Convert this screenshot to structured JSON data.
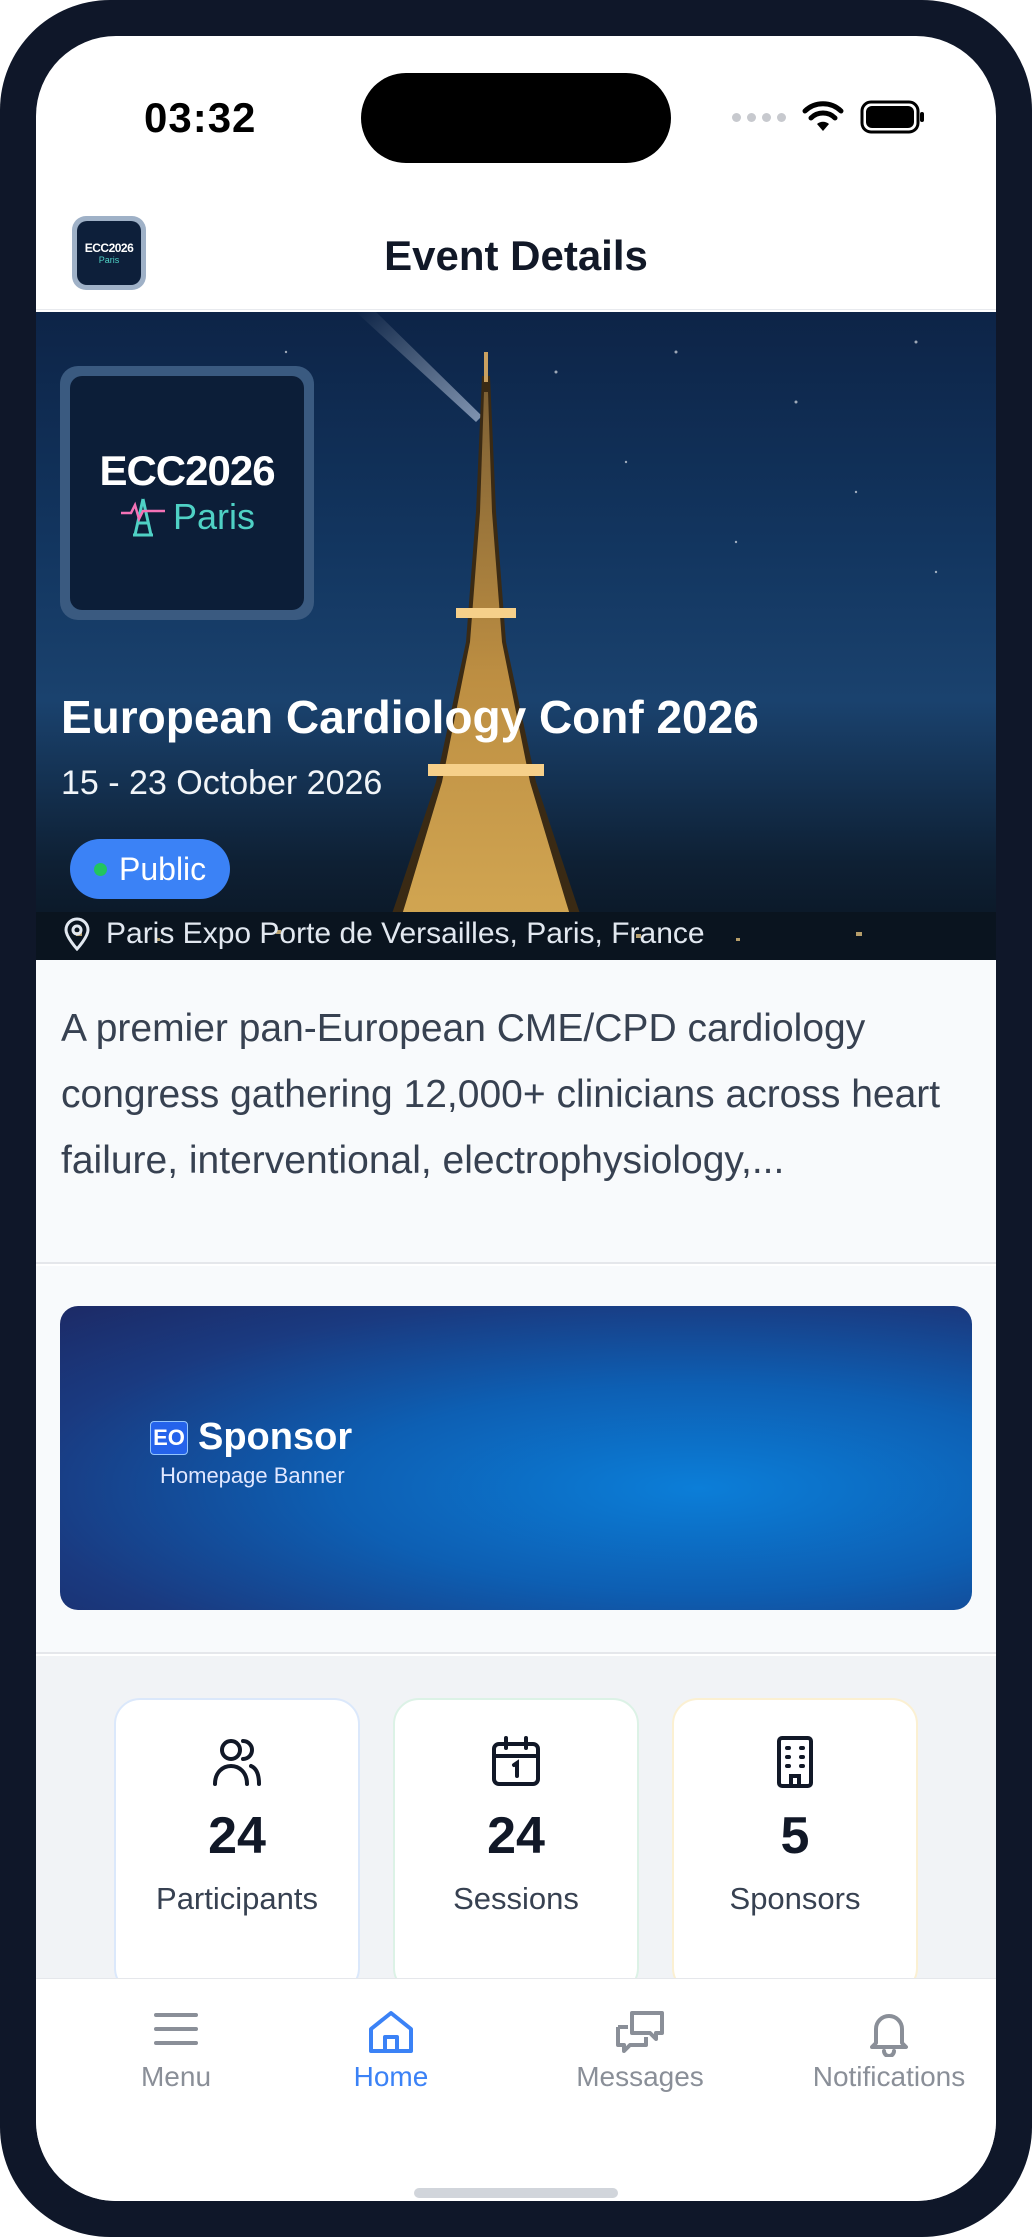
{
  "status_bar": {
    "time": "03:32"
  },
  "header": {
    "logo_text_1": "ECC2026",
    "logo_text_2": "Paris",
    "title": "Event Details"
  },
  "event": {
    "logo_text_1": "ECC2026",
    "logo_text_2": "Paris",
    "title": "European Cardiology Conf 2026",
    "dates": "15 - 23 October 2026",
    "visibility": "Public",
    "location": "Paris Expo Porte de Versailles, Paris, France"
  },
  "description": "A premier pan-European CME/CPD cardiology congress gathering 12,000+ clinicians across heart failure, interventional, electrophysiology,...",
  "banner": {
    "badge": "EO",
    "title": "Sponsor",
    "subtitle": "Homepage Banner"
  },
  "stats": [
    {
      "icon": "users-icon",
      "value": "24",
      "label": "Participants"
    },
    {
      "icon": "calendar-icon",
      "value": "24",
      "label": "Sessions"
    },
    {
      "icon": "building-icon",
      "value": "5",
      "label": "Sponsors"
    }
  ],
  "nav": [
    {
      "icon": "menu-icon",
      "label": "Menu",
      "active": false
    },
    {
      "icon": "home-icon",
      "label": "Home",
      "active": true
    },
    {
      "icon": "messages-icon",
      "label": "Messages",
      "active": false
    },
    {
      "icon": "bell-icon",
      "label": "Notifications",
      "active": false
    }
  ],
  "colors": {
    "accent": "#3b82f6",
    "status_green": "#22c55e",
    "frame": "#0f1729",
    "logo_teal": "#4fd1c5"
  }
}
